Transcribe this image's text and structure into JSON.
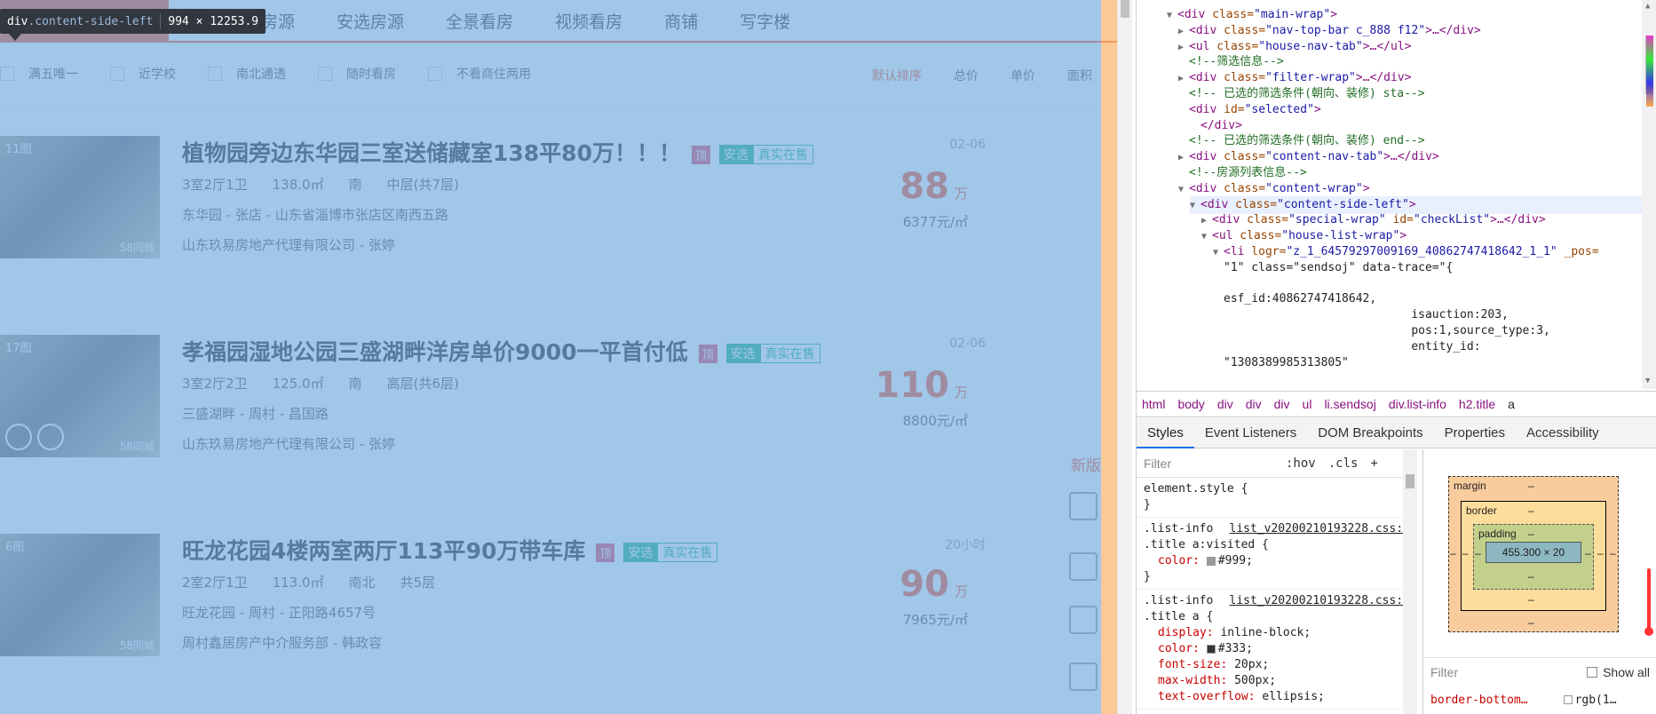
{
  "page": {
    "topbar": {
      "nav_items": [
        "源",
        "个人房源",
        "安选房源",
        "全景看房",
        "视频看房",
        "商铺",
        "写字楼"
      ]
    },
    "filters": [
      "满五唯一",
      "近学校",
      "南北通透",
      "随时看房",
      "不看商住两用"
    ],
    "sort": [
      "默认排序",
      "总价",
      "单价",
      "面积"
    ],
    "listings": [
      {
        "photo_count": "11图",
        "watermark": "58同城",
        "title": "植物园旁边东华园三室送储藏室138平80万！！！",
        "tag_top": "顶",
        "tag_safe": "安选",
        "tag_real": "真实在售",
        "layout": "3室2厅1卫",
        "area": "138.0㎡",
        "orientation": "南",
        "floor": "中层(共7层)",
        "address": "东华园 - 张店 - 山东省淄博市张店区南西五路",
        "agency": "山东玖易房地产代理有限公司 - 张婷",
        "date": "02-06",
        "price": "88",
        "price_unit": "万",
        "unit_price": "6377元/㎡"
      },
      {
        "photo_count": "17图",
        "watermark": "58同城",
        "title": "孝福园湿地公园三盛湖畔洋房单价9000一平首付低",
        "tag_top": "顶",
        "tag_safe": "安选",
        "tag_real": "真实在售",
        "layout": "3室2厅2卫",
        "area": "125.0㎡",
        "orientation": "南",
        "floor": "高层(共6层)",
        "address": "三盛湖畔 - 周村 - 昌国路",
        "agency": "山东玖易房地产代理有限公司 - 张婷",
        "date": "02-06",
        "price": "110",
        "price_unit": "万",
        "unit_price": "8800元/㎡"
      },
      {
        "photo_count": "6图",
        "watermark": "58同城",
        "title": "旺龙花园4楼两室两厅113平90万带车库",
        "tag_top": "顶",
        "tag_safe": "安选",
        "tag_real": "真实在售",
        "layout": "2室2厅1卫",
        "area": "113.0㎡",
        "orientation": "南北",
        "floor": "共5层",
        "address": "旺龙花园 - 周村 - 正阳路4657号",
        "agency": "周村鑫居房产中介服务部 - 韩政容",
        "date": "20小时",
        "price": "90",
        "price_unit": "万",
        "unit_price": "7965元/㎡"
      }
    ],
    "side_float": {
      "new_label": "新版"
    },
    "highlight": {
      "tag": "div",
      "cls": ".content-side-left",
      "dims": "994 × 12253.9"
    }
  },
  "devtools": {
    "dom_lines": [
      {
        "indent": 3,
        "tri": "▼",
        "html": "<div class=\"main-wrap\">"
      },
      {
        "indent": 4,
        "tri": "▶",
        "html": "<div class=\"nav-top-bar c_888 f12\">…</div>"
      },
      {
        "indent": 4,
        "tri": "▶",
        "html": "<ul class=\"house-nav-tab\">…</ul>"
      },
      {
        "indent": 4,
        "tri": "",
        "comment": "<!--筛选信息-->"
      },
      {
        "indent": 4,
        "tri": "▶",
        "html": "<div class=\"filter-wrap\">…</div>"
      },
      {
        "indent": 4,
        "tri": "",
        "comment": "<!-- 已选的筛选条件(朝向、装修) sta-->"
      },
      {
        "indent": 4,
        "tri": "",
        "html": "<div id=\"selected\">"
      },
      {
        "indent": 5,
        "tri": "",
        "html": "</div>"
      },
      {
        "indent": 4,
        "tri": "",
        "comment": "<!-- 已选的筛选条件(朝向、装修) end-->"
      },
      {
        "indent": 4,
        "tri": "▶",
        "html": "<div class=\"content-nav-tab\">…</div>"
      },
      {
        "indent": 4,
        "tri": "",
        "comment": "<!--房源列表信息-->"
      },
      {
        "indent": 4,
        "tri": "▼",
        "html": "<div class=\"content-wrap\">"
      },
      {
        "indent": 5,
        "tri": "▼",
        "html": "<div class=\"content-side-left\">",
        "selected": true
      },
      {
        "indent": 6,
        "tri": "▶",
        "html": "<div class=\"special-wrap\" id=\"checkList\">…</div>"
      },
      {
        "indent": 6,
        "tri": "▼",
        "html": "<ul class=\"house-list-wrap\">"
      },
      {
        "indent": 7,
        "tri": "▼",
        "html": "<li logr=\"z_1_64579297009169_40862747418642_1_1\" _pos="
      },
      {
        "indent": 7,
        "tri": "",
        "text": "\"1\" class=\"sendsoj\" data-trace=\"{"
      },
      {
        "indent": 7,
        "tri": "",
        "text": ""
      },
      {
        "indent": 7,
        "tri": "",
        "text": "esf_id:40862747418642,"
      },
      {
        "indent": 7,
        "tri": "",
        "text": "                           isauction:203,"
      },
      {
        "indent": 7,
        "tri": "",
        "text": "                           pos:1,source_type:3,"
      },
      {
        "indent": 7,
        "tri": "",
        "text": "                           entity_id:"
      },
      {
        "indent": 7,
        "tri": "",
        "text": "\"1308389985313805\""
      }
    ],
    "breadcrumbs": [
      "html",
      "body",
      "div",
      "div",
      "div",
      "ul",
      "li.sendsoj",
      "div.list-info",
      "h2.title",
      "a"
    ],
    "tabs": [
      "Styles",
      "Event Listeners",
      "DOM Breakpoints",
      "Properties",
      "Accessibility"
    ],
    "styles_filter_placeholder": "Filter",
    "styles_filter_opts": [
      ":hov",
      ".cls",
      "+"
    ],
    "rules": [
      {
        "selector": "element.style {",
        "source": "",
        "props": [],
        "close": "}"
      },
      {
        "selector": ".list-info .title a:visited {",
        "source": "list_v20200210193228.css:1",
        "props": [
          {
            "name": "color",
            "value": "#999;",
            "swatch": "#999999"
          }
        ],
        "close": "}"
      },
      {
        "selector": ".list-info .title a {",
        "source": "list_v20200210193228.css:1",
        "props": [
          {
            "name": "display",
            "value": "inline-block;"
          },
          {
            "name": "color",
            "value": "#333;",
            "swatch": "#333333"
          },
          {
            "name": "font-size",
            "value": "20px;"
          },
          {
            "name": "max-width",
            "value": "500px;"
          },
          {
            "name": "text-overflow",
            "value": "ellipsis;"
          }
        ],
        "close": ""
      }
    ],
    "boxmodel": {
      "margin_label": "margin",
      "border_label": "border",
      "padding_label": "padding",
      "dash": "–",
      "content": "455.300 × 20"
    },
    "computed_filter": "Filter",
    "show_all": "Show all",
    "computed_prop": "border-bottom…",
    "computed_val": "rgb(1…"
  }
}
